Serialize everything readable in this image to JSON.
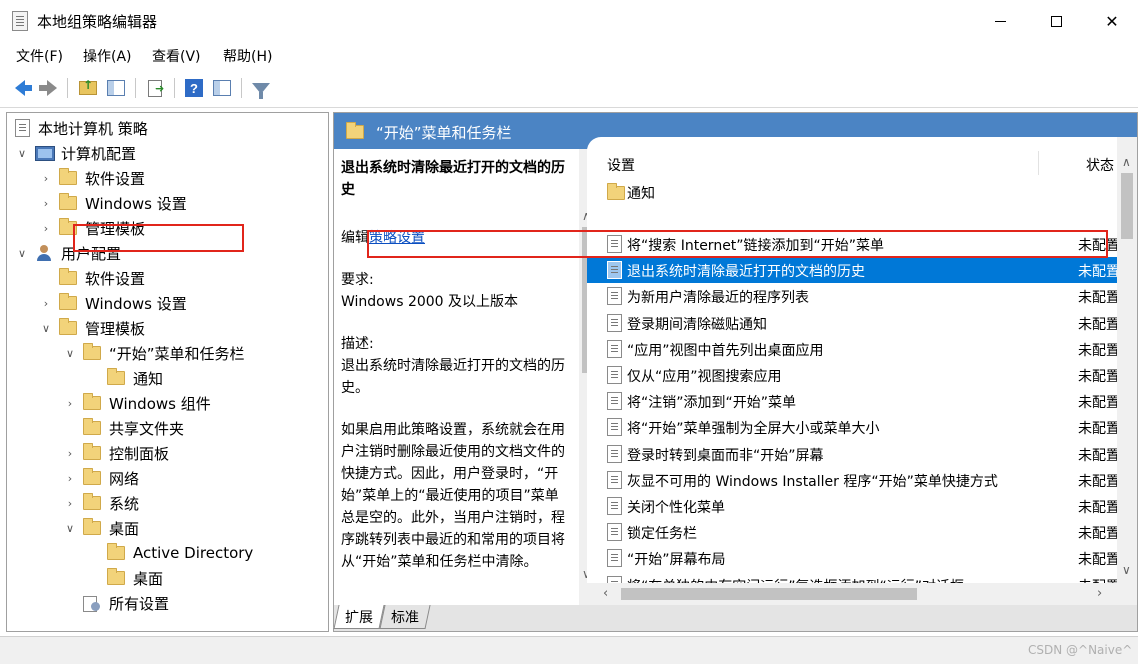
{
  "window": {
    "title": "本地组策略编辑器",
    "minimize_icon": "minimize-icon",
    "maximize_icon": "maximize-icon",
    "close_glyph": "✕"
  },
  "menu": [
    "文件(F)",
    "操作(A)",
    "查看(V)",
    "帮助(H)"
  ],
  "toolbar": {
    "icons": [
      "back-arrow-icon",
      "forward-arrow-icon",
      "folder-up-icon",
      "show-hide-pane-icon",
      "export-list-icon",
      "help-icon",
      "properties-icon",
      "filter-icon"
    ],
    "help_glyph": "?"
  },
  "tree": {
    "root": "本地计算机 策略",
    "computer_config": "计算机配置",
    "software_settings_1": "软件设置",
    "windows_settings_1": "Windows 设置",
    "admin_templates_1": "管理模板",
    "user_config": "用户配置",
    "software_settings_2": "软件设置",
    "windows_settings_2": "Windows 设置",
    "admin_templates_2": "管理模板",
    "start_menu_taskbar": "“开始”菜单和任务栏",
    "notifications": "通知",
    "windows_components": "Windows 组件",
    "shared_folders": "共享文件夹",
    "control_panel": "控制面板",
    "network": "网络",
    "system": "系统",
    "desktop": "桌面",
    "active_directory": "Active Directory",
    "desktop_sub": "桌面",
    "all_settings": "所有设置"
  },
  "right_header": {
    "title": "“开始”菜单和任务栏"
  },
  "description": {
    "policy_title": "退出系统时清除最近打开的文档的历史",
    "edit_prefix": "编辑",
    "edit_link": "策略设置",
    "requirements_label": "要求:",
    "requirements_value": "Windows 2000 及以上版本",
    "description_label": "描述:",
    "description_value": "退出系统时清除最近打开的文档的历史。",
    "detail": "如果启用此策略设置，系统就会在用户注销时删除最近使用的文档文件的快捷方式。因此，用户登录时，“开始”菜单上的“最近使用的项目”菜单总是空的。此外，当用户注销时，程序跳转列表中最近的和常用的项目将从“开始”菜单和任务栏中清除。"
  },
  "list": {
    "col_setting": "设置",
    "col_state": "状态",
    "folder_row": "通知",
    "rows": [
      {
        "name": "将“搜索 Internet”链接添加到“开始”菜单",
        "state": "未配置"
      },
      {
        "name": "退出系统时清除最近打开的文档的历史",
        "state": "未配置"
      },
      {
        "name": "为新用户清除最近的程序列表",
        "state": "未配置"
      },
      {
        "name": "登录期间清除磁贴通知",
        "state": "未配置"
      },
      {
        "name": "“应用”视图中首先列出桌面应用",
        "state": "未配置"
      },
      {
        "name": "仅从“应用”视图搜索应用",
        "state": "未配置"
      },
      {
        "name": "将“注销”添加到“开始”菜单",
        "state": "未配置"
      },
      {
        "name": "将“开始”菜单强制为全屏大小或菜单大小",
        "state": "未配置"
      },
      {
        "name": "登录时转到桌面而非“开始”屏幕",
        "state": "未配置"
      },
      {
        "name": "灰显不可用的 Windows Installer 程序“开始”菜单快捷方式",
        "state": "未配置"
      },
      {
        "name": "关闭个性化菜单",
        "state": "未配置"
      },
      {
        "name": "锁定任务栏",
        "state": "未配置"
      },
      {
        "name": "“开始”屏幕布局",
        "state": "未配置"
      },
      {
        "name": "将“在单独的内存空间运行”复选框添加到“运行”对话框",
        "state": "未配置"
      }
    ],
    "selected_index": 1
  },
  "tabs": [
    "扩展",
    "标准"
  ],
  "status": {
    "watermark": "CSDN @^Naive^"
  },
  "colors": {
    "selection": "#0078d7",
    "header": "#4b84c4",
    "highlight_box": "#e1251b"
  }
}
